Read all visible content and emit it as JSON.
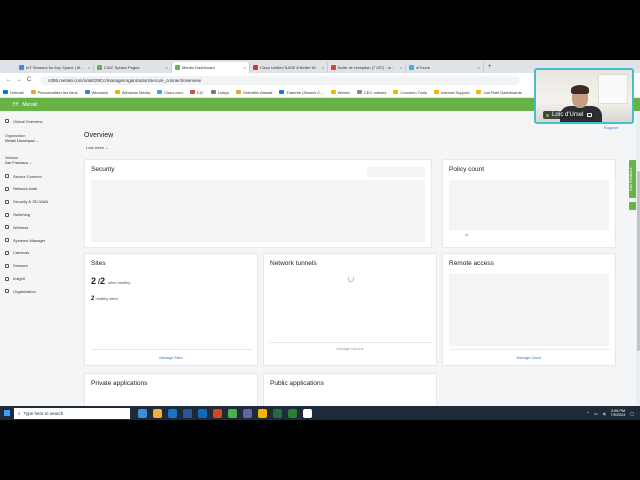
{
  "browser": {
    "tabs": [
      {
        "label": "IoT Sensors for Any Space | M...",
        "color": "#4a86d9"
      },
      {
        "label": "CIAC Splash Pages",
        "color": "#67b346"
      },
      {
        "label": "Meraki Dashboard",
        "color": "#67b346",
        "active": true
      },
      {
        "label": "Cisco Unified SASE A Better W...",
        "color": "#e0332a"
      },
      {
        "label": "Boîte de réception (7 257) - lo...",
        "color": "#d9452c"
      },
      {
        "label": "mTouch",
        "color": "#3ab0e5"
      }
    ],
    "new_tab": "+",
    "nav": {
      "back": "←",
      "forward": "→",
      "reload": "C"
    },
    "url": "n395.meraki.com/o/a6029Cc/manage/organization/secure_connect/overview",
    "bookmarks": [
      "Hotmail",
      "Personnaliser les liens",
      "Windows",
      "Windows Media",
      "Cisco.com",
      "CIC",
      "Linkys",
      "Scientific Atlanta",
      "Tramme (Search C...",
      "Webex",
      "CEC roleses",
      "Common Tools",
      "Internal Support",
      "Job Role Dashboards"
    ]
  },
  "app": {
    "name": "Meraki",
    "logo_icon": "meraki-grid-icon",
    "accent": "#67b346"
  },
  "sidebar": {
    "items_top": [
      {
        "label": "Global Overview"
      }
    ],
    "organization": {
      "heading": "Organization",
      "value": "Meraki Launchpad"
    },
    "network": {
      "heading": "Network",
      "value": "San Francisco"
    },
    "items": [
      {
        "label": "Secure Connect"
      },
      {
        "label": "Network-wide"
      },
      {
        "label": "Security & SD-WAN"
      },
      {
        "label": "Switching"
      },
      {
        "label": "Wireless"
      },
      {
        "label": "Systems Manager"
      },
      {
        "label": "Cameras"
      },
      {
        "label": "Sensors"
      },
      {
        "label": "Insight"
      },
      {
        "label": "Organization"
      }
    ]
  },
  "main": {
    "title": "Overview",
    "range": "Last week",
    "support": "Support",
    "cards": {
      "security": {
        "title": "Security"
      },
      "policy": {
        "title": "Policy count"
      },
      "sites": {
        "title": "Sites",
        "count": "2",
        "total": "2",
        "count_label": "sites healthy",
        "healthy": "2",
        "healthy_label": "healthy sites",
        "link": "Manage Sites"
      },
      "tunnels": {
        "title": "Network tunnels",
        "link": "Manage tunnels"
      },
      "remote": {
        "title": "Remote access",
        "link": "Manage Users"
      },
      "private": {
        "title": "Private applications"
      },
      "public": {
        "title": "Public applications"
      }
    },
    "feedback": "Give Feedback"
  },
  "webcam": {
    "name": "Loïc d'Ursel"
  },
  "taskbar": {
    "search_placeholder": "Type here to search",
    "time": "2:06 PM",
    "date": "7/9/2024",
    "apps": [
      "#3c8fd6",
      "#f2b134",
      "#1a73c7",
      "#2b579a",
      "#0f6cbd",
      "#d24726",
      "#4caf50",
      "#6264a7",
      "#f4b400",
      "#1d6f42",
      "#2e7d32",
      "#ffffff"
    ]
  }
}
